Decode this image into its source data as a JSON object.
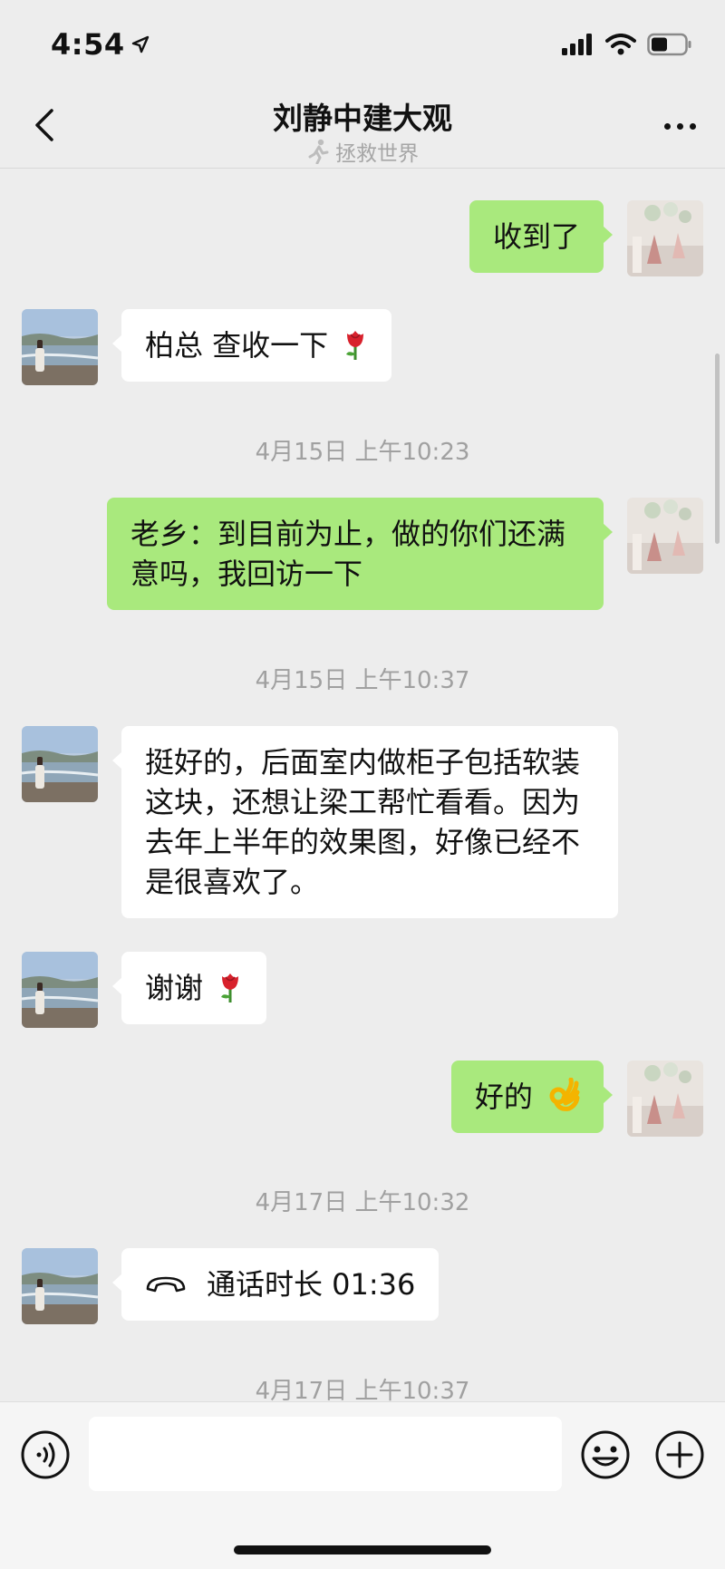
{
  "status_bar": {
    "time": "4:54"
  },
  "header": {
    "title": "刘静中建大观",
    "subtitle": "拯救世界"
  },
  "messages": [
    {
      "side": "out",
      "text": "收到了"
    },
    {
      "side": "in",
      "text": "柏总 查收一下"
    },
    {
      "timestamp": "4月15日 上午10:23"
    },
    {
      "side": "out",
      "text": "老乡：到目前为止，做的你们还满意吗，我回访一下"
    },
    {
      "timestamp": "4月15日 上午10:37"
    },
    {
      "side": "in",
      "text": "挺好的，后面室内做柜子包括软装这块，还想让梁工帮忙看看。因为去年上半年的效果图，好像已经不是很喜欢了。"
    },
    {
      "side": "in",
      "text": "谢谢"
    },
    {
      "side": "out",
      "text": "好的"
    },
    {
      "timestamp": "4月17日 上午10:32"
    },
    {
      "side": "in",
      "call": true,
      "text": "通话时长 01:36"
    },
    {
      "timestamp": "4月17日 上午10:37"
    }
  ],
  "input": {
    "value": ""
  },
  "icons": {
    "back": "chevron-left-icon",
    "more": "more-dots-icon",
    "subtitle": "running-figure-icon",
    "rose": "rose-emoji",
    "ok": "ok-hand-emoji",
    "call": "phone-handset-icon",
    "voice": "voice-icon",
    "emoji": "smiley-icon",
    "plus": "plus-circle-icon"
  },
  "colors": {
    "outgoing_bubble": "#a9e97d",
    "incoming_bubble": "#ffffff",
    "background": "#ededed"
  }
}
